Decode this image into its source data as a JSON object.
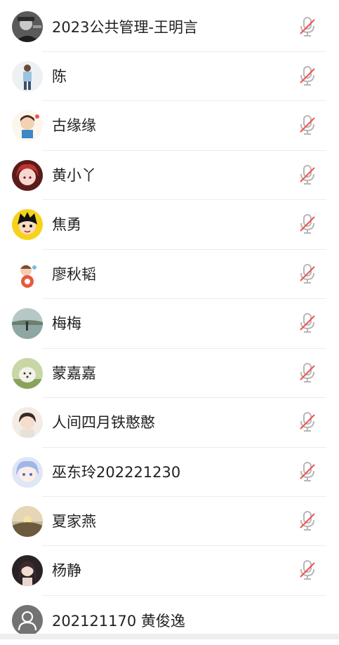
{
  "members": [
    {
      "name": "2023公共管理-王明言",
      "avatar": "avatar-bw-portrait",
      "muted": true
    },
    {
      "name": "陈",
      "avatar": "avatar-standing-girl",
      "muted": true
    },
    {
      "name": "古缘缘",
      "avatar": "avatar-cartoon-girl",
      "muted": true
    },
    {
      "name": "黄小丫",
      "avatar": "avatar-anime-red-hair",
      "muted": true
    },
    {
      "name": "焦勇",
      "avatar": "avatar-cartoon-boy-yellow",
      "muted": true
    },
    {
      "name": "廖秋韬",
      "avatar": "avatar-doll",
      "muted": true
    },
    {
      "name": "梅梅",
      "avatar": "avatar-lake-scene",
      "muted": true
    },
    {
      "name": "蒙嘉嘉",
      "avatar": "avatar-white-dog",
      "muted": true
    },
    {
      "name": "人间四月铁憨憨",
      "avatar": "avatar-girl-photo",
      "muted": true
    },
    {
      "name": "巫东玲202221230",
      "avatar": "avatar-anime-blue-hair",
      "muted": true
    },
    {
      "name": "夏家燕",
      "avatar": "avatar-sunset-landscape",
      "muted": true
    },
    {
      "name": "杨静",
      "avatar": "avatar-dark-hair-girl",
      "muted": true
    },
    {
      "name": "202121170 黄俊逸",
      "avatar": "avatar-default-person",
      "muted": false
    }
  ],
  "colors": {
    "mic_gray": "#b7b7b7",
    "mic_slash_red": "#ef5350",
    "separator": "#ececec",
    "text": "#222222"
  }
}
